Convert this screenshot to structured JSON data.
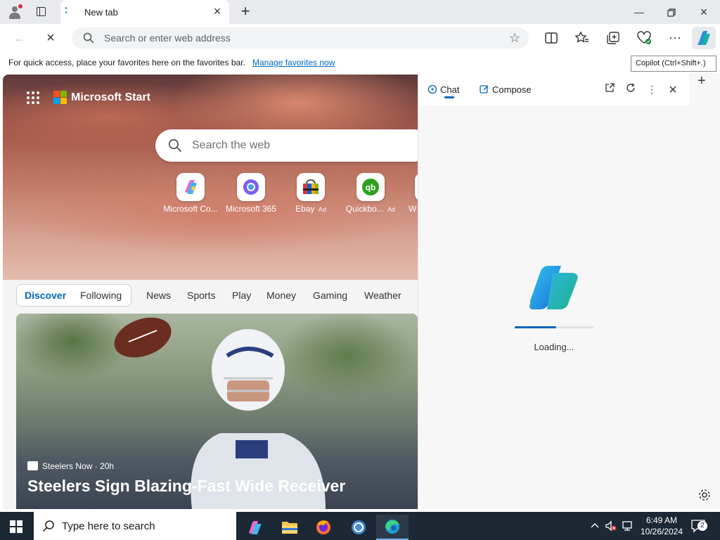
{
  "browser": {
    "tab": {
      "title": "New tab"
    },
    "address": {
      "placeholder": "Search or enter web address"
    },
    "tooltip": "Copilot (Ctrl+Shift+.)",
    "favorites_bar": {
      "message": "For quick access, place your favorites here on the favorites bar.",
      "link": "Manage favorites now"
    }
  },
  "newtab": {
    "brand": "Microsoft Start",
    "search_placeholder": "Search the web",
    "quick_links": [
      {
        "label": "Microsoft Co...",
        "ad": ""
      },
      {
        "label": "Microsoft 365",
        "ad": ""
      },
      {
        "label": "Ebay",
        "ad": "Ad"
      },
      {
        "label": "Quickbo...",
        "ad": "Ad"
      },
      {
        "label": "W",
        "ad": ""
      }
    ],
    "feed_tabs": [
      "Discover",
      "Following",
      "News",
      "Sports",
      "Play",
      "Money",
      "Gaming",
      "Weather"
    ],
    "article": {
      "source": "Steelers Now",
      "age": "20h",
      "source_line": "Steelers Now · 20h",
      "headline": "Steelers Sign Blazing-Fast Wide Receiver"
    }
  },
  "copilot": {
    "tabs": [
      "Chat",
      "Compose"
    ],
    "loading_text": "Loading...",
    "loading_progress": 0.53
  },
  "taskbar": {
    "search_placeholder": "Type here to search",
    "time": "6:49 AM",
    "date": "10/26/2024",
    "notification_count": "2"
  },
  "colors": {
    "accent": "#0067c0",
    "taskbar_bg": "#1c2834"
  }
}
